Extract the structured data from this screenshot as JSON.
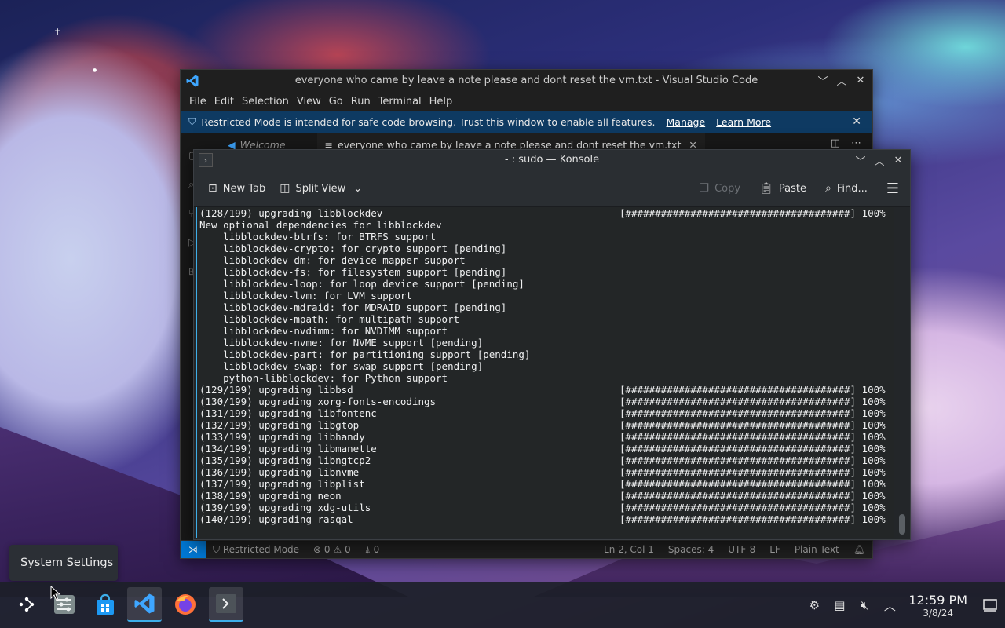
{
  "vscode": {
    "title": "everyone who came by leave a note please and dont reset the vm.txt - Visual Studio Code",
    "menu": [
      "File",
      "Edit",
      "Selection",
      "View",
      "Go",
      "Run",
      "Terminal",
      "Help"
    ],
    "banner": {
      "text": "Restricted Mode is intended for safe code browsing. Trust this window to enable all features.",
      "manage": "Manage",
      "learn_more": "Learn More"
    },
    "tabs": {
      "welcome": "Welcome",
      "file": "everyone who came by leave a note please and dont reset the vm.txt"
    },
    "status": {
      "restricted": "Restricted Mode",
      "errors": "0",
      "warnings": "0",
      "ports": "0",
      "position": "Ln 2, Col 1",
      "spaces": "Spaces: 4",
      "encoding": "UTF-8",
      "eol": "LF",
      "language": "Plain Text"
    }
  },
  "konsole": {
    "title": "- : sudo — Konsole",
    "toolbar": {
      "new_tab": "New Tab",
      "split_view": "Split View",
      "copy": "Copy",
      "paste": "Paste",
      "find": "Find..."
    },
    "lines": [
      {
        "text": "(128/199) upgrading libblockdev",
        "bar": "[######################################] 100%"
      },
      {
        "text": "New optional dependencies for libblockdev",
        "bar": ""
      },
      {
        "text": "    libblockdev-btrfs: for BTRFS support",
        "bar": ""
      },
      {
        "text": "    libblockdev-crypto: for crypto support [pending]",
        "bar": ""
      },
      {
        "text": "    libblockdev-dm: for device-mapper support",
        "bar": ""
      },
      {
        "text": "    libblockdev-fs: for filesystem support [pending]",
        "bar": ""
      },
      {
        "text": "    libblockdev-loop: for loop device support [pending]",
        "bar": ""
      },
      {
        "text": "    libblockdev-lvm: for LVM support",
        "bar": ""
      },
      {
        "text": "    libblockdev-mdraid: for MDRAID support [pending]",
        "bar": ""
      },
      {
        "text": "    libblockdev-mpath: for multipath support",
        "bar": ""
      },
      {
        "text": "    libblockdev-nvdimm: for NVDIMM support",
        "bar": ""
      },
      {
        "text": "    libblockdev-nvme: for NVME support [pending]",
        "bar": ""
      },
      {
        "text": "    libblockdev-part: for partitioning support [pending]",
        "bar": ""
      },
      {
        "text": "    libblockdev-swap: for swap support [pending]",
        "bar": ""
      },
      {
        "text": "    python-libblockdev: for Python support",
        "bar": ""
      },
      {
        "text": "(129/199) upgrading libbsd",
        "bar": "[######################################] 100%"
      },
      {
        "text": "(130/199) upgrading xorg-fonts-encodings",
        "bar": "[######################################] 100%"
      },
      {
        "text": "(131/199) upgrading libfontenc",
        "bar": "[######################################] 100%"
      },
      {
        "text": "(132/199) upgrading libgtop",
        "bar": "[######################################] 100%"
      },
      {
        "text": "(133/199) upgrading libhandy",
        "bar": "[######################################] 100%"
      },
      {
        "text": "(134/199) upgrading libmanette",
        "bar": "[######################################] 100%"
      },
      {
        "text": "(135/199) upgrading libngtcp2",
        "bar": "[######################################] 100%"
      },
      {
        "text": "(136/199) upgrading libnvme",
        "bar": "[######################################] 100%"
      },
      {
        "text": "(137/199) upgrading libplist",
        "bar": "[######################################] 100%"
      },
      {
        "text": "(138/199) upgrading neon",
        "bar": "[######################################] 100%"
      },
      {
        "text": "(139/199) upgrading xdg-utils",
        "bar": "[######################################] 100%"
      },
      {
        "text": "(140/199) upgrading rasqal",
        "bar": "[######################################] 100%"
      }
    ]
  },
  "tooltip": "System Settings",
  "taskbar": {
    "apps": [
      "app-launcher",
      "system-settings",
      "discover",
      "visual-studio-code",
      "firefox",
      "konsole"
    ],
    "clock_time": "12:59 PM",
    "clock_date": "3/8/24"
  },
  "colors": {
    "accent": "#3daee9",
    "vscode_blue": "#0078d4",
    "banner_bg": "#0e3a62"
  }
}
